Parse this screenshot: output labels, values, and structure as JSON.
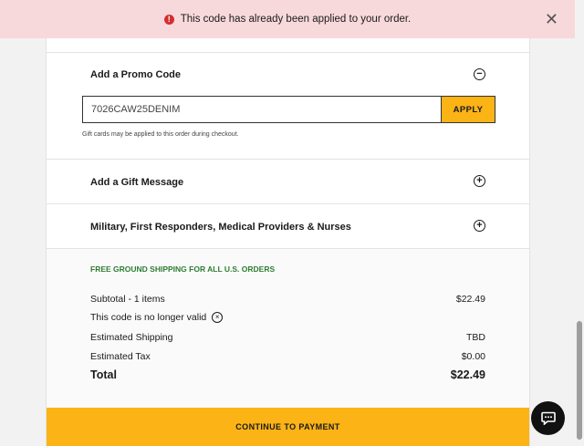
{
  "alert": {
    "icon": "exclamation-circle-icon",
    "glyph": "!",
    "message": "This code has already been applied to your order.",
    "close_glyph": "✕",
    "color": "#d32f2f"
  },
  "promo": {
    "title": "Add a Promo Code",
    "toggle_glyph": "−",
    "input_value": "7026CAW25DENIM",
    "apply_label": "APPLY",
    "hint": "Gift cards may be applied to this order during checkout."
  },
  "gift_message": {
    "title": "Add a Gift Message",
    "toggle_glyph": "+"
  },
  "military": {
    "title": "Military, First Responders, Medical Providers & Nurses",
    "toggle_glyph": "+"
  },
  "summary": {
    "free_shipping": "FREE GROUND SHIPPING FOR ALL U.S. ORDERS",
    "subtotal_label": "Subtotal - 1 items",
    "subtotal_value": "$22.49",
    "invalid_code_text": "This code is no longer valid",
    "remove_glyph": "×",
    "shipping_label": "Estimated Shipping",
    "shipping_value": "TBD",
    "tax_label": "Estimated Tax",
    "tax_value": "$0.00",
    "total_label": "Total",
    "total_value": "$22.49"
  },
  "continue_label": "CONTINUE TO PAYMENT",
  "chat": {
    "icon": "chat-bubble-icon"
  },
  "colors": {
    "accent": "#fbb316",
    "alert_bg": "#f8d9db",
    "success_text": "#2e7d32"
  }
}
